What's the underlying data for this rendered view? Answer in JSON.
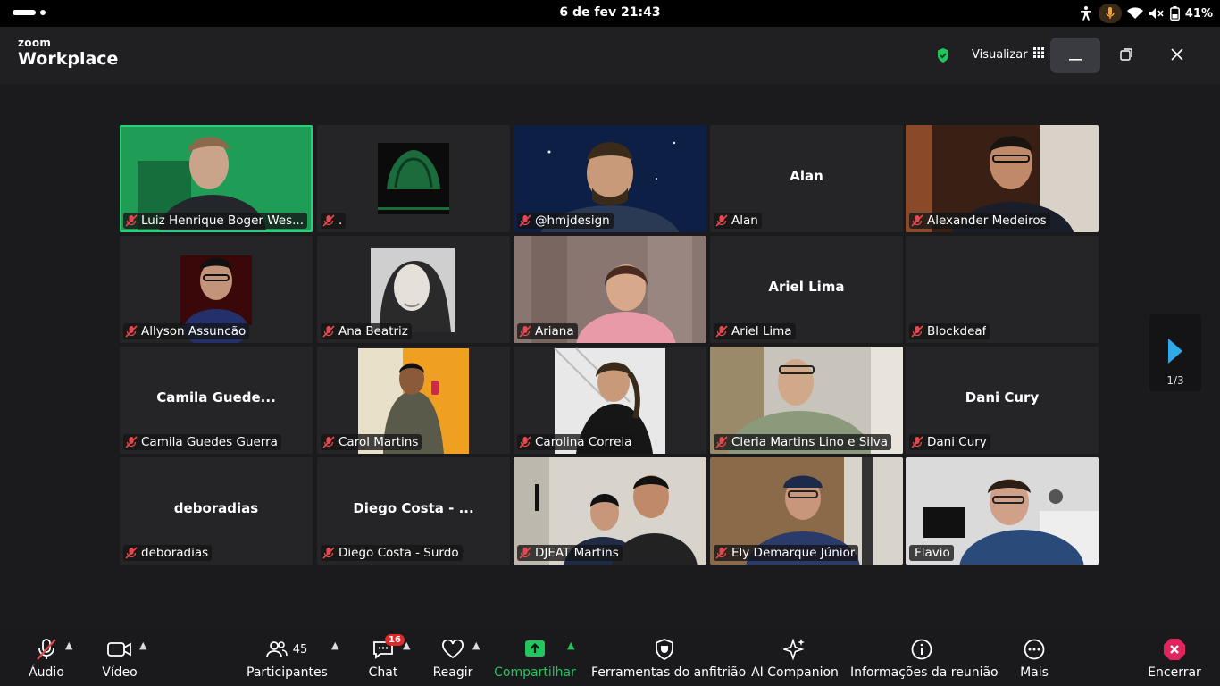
{
  "status_bar": {
    "date_time": "6 de fev  21:43",
    "battery": "41%"
  },
  "titlebar": {
    "brand_small": "zoom",
    "brand_big": "Workplace",
    "view_label": "Visualizar"
  },
  "participants": [
    {
      "label": "Luiz Henrique Boger Wes...",
      "center": ""
    },
    {
      "label": ".",
      "center": ""
    },
    {
      "label": "@hmjdesign",
      "center": ""
    },
    {
      "label": "Alan",
      "center": "Alan"
    },
    {
      "label": "Alexander Medeiros",
      "center": ""
    },
    {
      "label": "Allyson Assuncão",
      "center": ""
    },
    {
      "label": "Ana Beatriz",
      "center": ""
    },
    {
      "label": "Ariana",
      "center": ""
    },
    {
      "label": "Ariel Lima",
      "center": "Ariel Lima"
    },
    {
      "label": "Blockdeaf",
      "center": ""
    },
    {
      "label": "Camila Guedes Guerra",
      "center": "Camila Guede..."
    },
    {
      "label": "Carol Martins",
      "center": ""
    },
    {
      "label": "Carolina Correia",
      "center": ""
    },
    {
      "label": "Cleria Martins Lino e Silva",
      "center": ""
    },
    {
      "label": "Dani Cury",
      "center": "Dani Cury"
    },
    {
      "label": "deboradias",
      "center": "deboradias"
    },
    {
      "label": "Diego Costa - Surdo",
      "center": "Diego Costa - ..."
    },
    {
      "label": "DJEAT Martins",
      "center": ""
    },
    {
      "label": "Ely Demarque Júnior",
      "center": ""
    },
    {
      "label": "Flavio",
      "center": ""
    }
  ],
  "pager": {
    "text": "1/3"
  },
  "toolbar": {
    "audio": "Áudio",
    "video": "Vídeo",
    "participants": "Participantes",
    "participants_count": "45",
    "chat": "Chat",
    "chat_badge": "16",
    "react": "Reagir",
    "share": "Compartilhar",
    "host_tools": "Ferramentas do anfitrião",
    "ai": "AI Companion",
    "info": "Informações da reunião",
    "more": "Mais",
    "end": "Encerrar"
  },
  "colors": {
    "active_speaker": "#28d07a",
    "share_green": "#22c55e",
    "mute_red": "#e5484d",
    "end_red": "#e0245e"
  }
}
